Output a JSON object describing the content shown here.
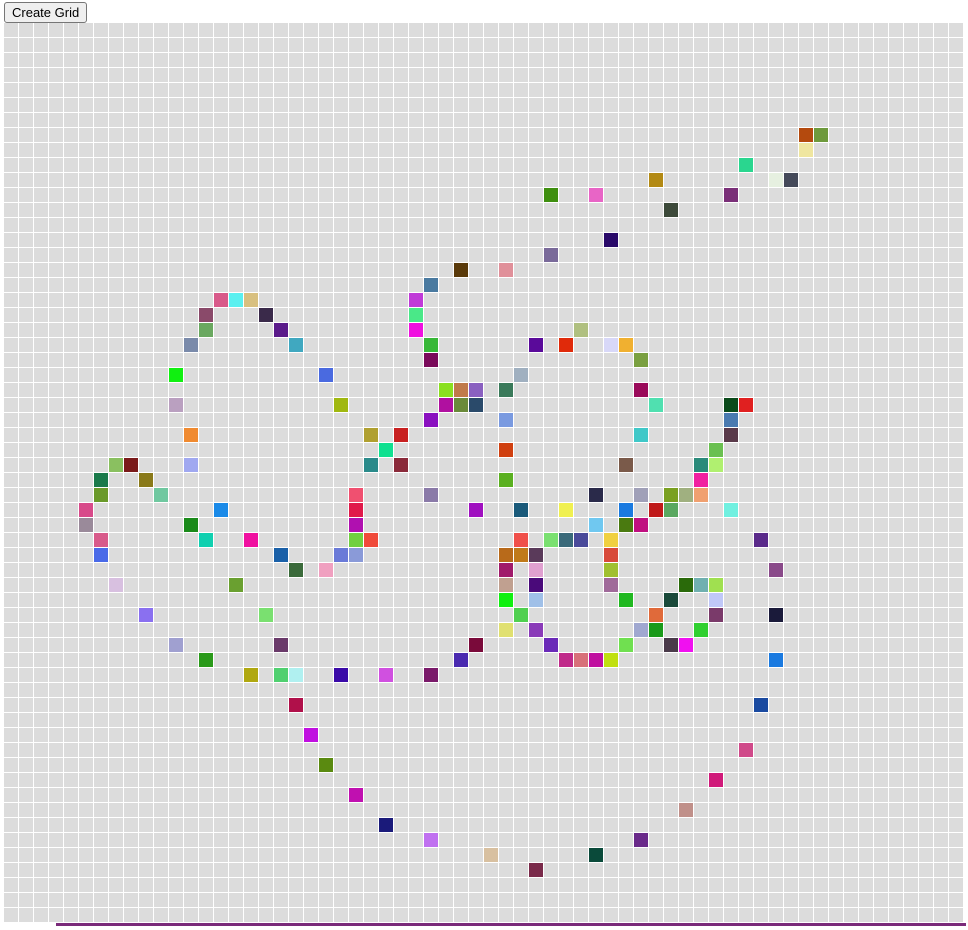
{
  "toolbar": {
    "create_grid_label": "Create Grid"
  },
  "grid": {
    "columns": 64,
    "rows": 60,
    "background_color": "#dcdcdc",
    "painted_cells": [
      [
        53,
        7,
        "#b44a0e"
      ],
      [
        54,
        7,
        "#6e9a3c"
      ],
      [
        53,
        8,
        "#efe6a0"
      ],
      [
        49,
        9,
        "#2ad68f"
      ],
      [
        43,
        10,
        "#b38a14"
      ],
      [
        51,
        10,
        "#e6f0e0"
      ],
      [
        52,
        10,
        "#454a5a"
      ],
      [
        36,
        11,
        "#3f8f0f"
      ],
      [
        39,
        11,
        "#e865c6"
      ],
      [
        48,
        11,
        "#7a2f78"
      ],
      [
        44,
        12,
        "#3d4a3a"
      ],
      [
        40,
        14,
        "#2a0a6a"
      ],
      [
        36,
        15,
        "#7a6a9a"
      ],
      [
        30,
        16,
        "#5a3a0a"
      ],
      [
        33,
        16,
        "#e0909a"
      ],
      [
        28,
        17,
        "#4a7aa0"
      ],
      [
        14,
        18,
        "#d85a8a"
      ],
      [
        15,
        18,
        "#5af0f0"
      ],
      [
        16,
        18,
        "#d8c080"
      ],
      [
        27,
        18,
        "#c03ad8"
      ],
      [
        13,
        19,
        "#8a4a6a"
      ],
      [
        17,
        19,
        "#3a2a4a"
      ],
      [
        27,
        19,
        "#4ae888"
      ],
      [
        13,
        20,
        "#6aa860"
      ],
      [
        18,
        20,
        "#5a1a8a"
      ],
      [
        27,
        20,
        "#f010e0"
      ],
      [
        38,
        20,
        "#b0c080"
      ],
      [
        12,
        21,
        "#7a8aaa"
      ],
      [
        19,
        21,
        "#40a8c0"
      ],
      [
        28,
        21,
        "#38b838"
      ],
      [
        35,
        21,
        "#5a0a9a"
      ],
      [
        37,
        21,
        "#e02a0a"
      ],
      [
        40,
        21,
        "#d8d8f8"
      ],
      [
        41,
        21,
        "#f0b030"
      ],
      [
        28,
        22,
        "#7a0a5a"
      ],
      [
        42,
        22,
        "#7aa040"
      ],
      [
        11,
        23,
        "#10f010"
      ],
      [
        21,
        23,
        "#4a6ae0"
      ],
      [
        34,
        23,
        "#a0b0c0"
      ],
      [
        29,
        24,
        "#8ae020"
      ],
      [
        30,
        24,
        "#c07a4a"
      ],
      [
        31,
        24,
        "#8a60c0"
      ],
      [
        33,
        24,
        "#3a7a5a"
      ],
      [
        42,
        24,
        "#9a0a5a"
      ],
      [
        11,
        25,
        "#baa0c0"
      ],
      [
        22,
        25,
        "#a0b810"
      ],
      [
        29,
        25,
        "#b010a0"
      ],
      [
        30,
        25,
        "#6a8a3a"
      ],
      [
        31,
        25,
        "#2a4a6a"
      ],
      [
        43,
        25,
        "#50e0b0"
      ],
      [
        48,
        25,
        "#0a4a1a"
      ],
      [
        49,
        25,
        "#e02020"
      ],
      [
        28,
        26,
        "#8a10c0"
      ],
      [
        33,
        26,
        "#7a9ae0"
      ],
      [
        48,
        26,
        "#4a7ab0"
      ],
      [
        12,
        27,
        "#f08a30"
      ],
      [
        24,
        27,
        "#b0a030"
      ],
      [
        26,
        27,
        "#c82020"
      ],
      [
        42,
        27,
        "#40c8c8"
      ],
      [
        48,
        27,
        "#5a3a4a"
      ],
      [
        25,
        28,
        "#10e090"
      ],
      [
        33,
        28,
        "#d04010"
      ],
      [
        47,
        28,
        "#6ac050"
      ],
      [
        7,
        29,
        "#8ac060"
      ],
      [
        8,
        29,
        "#7a1a1a"
      ],
      [
        12,
        29,
        "#a0a8f0"
      ],
      [
        24,
        29,
        "#2a8a8a"
      ],
      [
        26,
        29,
        "#8a2a3a"
      ],
      [
        41,
        29,
        "#7a5a4a"
      ],
      [
        46,
        29,
        "#2a8a7a"
      ],
      [
        47,
        29,
        "#b0f070"
      ],
      [
        6,
        30,
        "#1a7a4a"
      ],
      [
        9,
        30,
        "#8a7a1a"
      ],
      [
        33,
        30,
        "#5ab020"
      ],
      [
        46,
        30,
        "#f020a0"
      ],
      [
        6,
        31,
        "#6a9a2a"
      ],
      [
        10,
        31,
        "#70c8a0"
      ],
      [
        23,
        31,
        "#f05070"
      ],
      [
        28,
        31,
        "#8a7aa8"
      ],
      [
        39,
        31,
        "#2a2a4a"
      ],
      [
        42,
        31,
        "#a0a0b8"
      ],
      [
        44,
        31,
        "#7aa020"
      ],
      [
        45,
        31,
        "#a0b080"
      ],
      [
        46,
        31,
        "#f0a070"
      ],
      [
        5,
        32,
        "#d84a8a"
      ],
      [
        14,
        32,
        "#1a8ae8"
      ],
      [
        23,
        32,
        "#e01a4a"
      ],
      [
        31,
        32,
        "#a010c0"
      ],
      [
        34,
        32,
        "#1a5a7a"
      ],
      [
        37,
        32,
        "#f0f050"
      ],
      [
        41,
        32,
        "#1a7ae0"
      ],
      [
        43,
        32,
        "#c01a1a"
      ],
      [
        44,
        32,
        "#5aa860"
      ],
      [
        48,
        32,
        "#70f0e0"
      ],
      [
        5,
        33,
        "#9a8a9a"
      ],
      [
        12,
        33,
        "#1a8a1a"
      ],
      [
        23,
        33,
        "#b010b0"
      ],
      [
        39,
        33,
        "#70c8f0"
      ],
      [
        41,
        33,
        "#4a7a10"
      ],
      [
        42,
        33,
        "#c01080"
      ],
      [
        6,
        34,
        "#d85a8a"
      ],
      [
        13,
        34,
        "#10d0b0"
      ],
      [
        16,
        34,
        "#f010a0"
      ],
      [
        23,
        34,
        "#70d040"
      ],
      [
        24,
        34,
        "#f04a3a"
      ],
      [
        34,
        34,
        "#f0504a"
      ],
      [
        36,
        34,
        "#7ae070"
      ],
      [
        37,
        34,
        "#3a6a7a"
      ],
      [
        38,
        34,
        "#4a4a9a"
      ],
      [
        40,
        34,
        "#f0d040"
      ],
      [
        50,
        34,
        "#5a2a8a"
      ],
      [
        6,
        35,
        "#4a6ae8"
      ],
      [
        18,
        35,
        "#1a60a8"
      ],
      [
        22,
        35,
        "#6a7ad8"
      ],
      [
        23,
        35,
        "#8a9ad8"
      ],
      [
        33,
        35,
        "#b86a1a"
      ],
      [
        34,
        35,
        "#c07a1a"
      ],
      [
        35,
        35,
        "#5a3a5a"
      ],
      [
        40,
        35,
        "#d84a3a"
      ],
      [
        19,
        36,
        "#3a6a3a"
      ],
      [
        21,
        36,
        "#f0a0c0"
      ],
      [
        33,
        36,
        "#a01a6a"
      ],
      [
        35,
        36,
        "#e0a0d0"
      ],
      [
        40,
        36,
        "#a0c030"
      ],
      [
        51,
        36,
        "#8a4a8a"
      ],
      [
        7,
        37,
        "#d8c0e0"
      ],
      [
        15,
        37,
        "#6aa030"
      ],
      [
        33,
        37,
        "#c0a090"
      ],
      [
        35,
        37,
        "#4a0a7a"
      ],
      [
        40,
        37,
        "#a06a9a"
      ],
      [
        45,
        37,
        "#2a6a0a"
      ],
      [
        46,
        37,
        "#70b0b0"
      ],
      [
        47,
        37,
        "#a0e050"
      ],
      [
        33,
        38,
        "#10f010"
      ],
      [
        35,
        38,
        "#a0c0e8"
      ],
      [
        41,
        38,
        "#20b820"
      ],
      [
        44,
        38,
        "#1a4a3a"
      ],
      [
        47,
        38,
        "#c0c8f8"
      ],
      [
        9,
        39,
        "#8a70f0"
      ],
      [
        17,
        39,
        "#7ae070"
      ],
      [
        34,
        39,
        "#50d050"
      ],
      [
        43,
        39,
        "#e06a3a"
      ],
      [
        47,
        39,
        "#7a3a6a"
      ],
      [
        51,
        39,
        "#1a1a3a"
      ],
      [
        33,
        40,
        "#e0e070"
      ],
      [
        35,
        40,
        "#8a3ab8"
      ],
      [
        42,
        40,
        "#a0a8d0"
      ],
      [
        43,
        40,
        "#1a9a1a"
      ],
      [
        46,
        40,
        "#30d030"
      ],
      [
        11,
        41,
        "#a0a0d0"
      ],
      [
        18,
        41,
        "#6a3a6a"
      ],
      [
        31,
        41,
        "#7a0a3a"
      ],
      [
        36,
        41,
        "#6a2ab8"
      ],
      [
        41,
        41,
        "#70e050"
      ],
      [
        44,
        41,
        "#4a3a4a"
      ],
      [
        45,
        41,
        "#f010f0"
      ],
      [
        13,
        42,
        "#2a9a1a"
      ],
      [
        30,
        42,
        "#4a2ab0"
      ],
      [
        37,
        42,
        "#c02a8a"
      ],
      [
        38,
        42,
        "#d8707a"
      ],
      [
        39,
        42,
        "#c010a0"
      ],
      [
        40,
        42,
        "#c0e010"
      ],
      [
        51,
        42,
        "#1a7ae0"
      ],
      [
        16,
        43,
        "#b0a810"
      ],
      [
        18,
        43,
        "#50d070"
      ],
      [
        19,
        43,
        "#b0f0f0"
      ],
      [
        22,
        43,
        "#3a0aa8"
      ],
      [
        25,
        43,
        "#d050e0"
      ],
      [
        28,
        43,
        "#7a1a6a"
      ],
      [
        19,
        45,
        "#b0104a"
      ],
      [
        50,
        45,
        "#1a4aa0"
      ],
      [
        20,
        47,
        "#c010e0"
      ],
      [
        49,
        48,
        "#d04a8a"
      ],
      [
        21,
        49,
        "#5a8a10"
      ],
      [
        47,
        50,
        "#d01a7a"
      ],
      [
        23,
        51,
        "#c010b0"
      ],
      [
        45,
        52,
        "#c0908a"
      ],
      [
        25,
        53,
        "#1a1a7a"
      ],
      [
        28,
        54,
        "#c070f0"
      ],
      [
        42,
        54,
        "#6a2a8a"
      ],
      [
        32,
        55,
        "#d8c0a0"
      ],
      [
        39,
        55,
        "#0a4a3a"
      ],
      [
        35,
        56,
        "#7a2a4a"
      ]
    ]
  }
}
